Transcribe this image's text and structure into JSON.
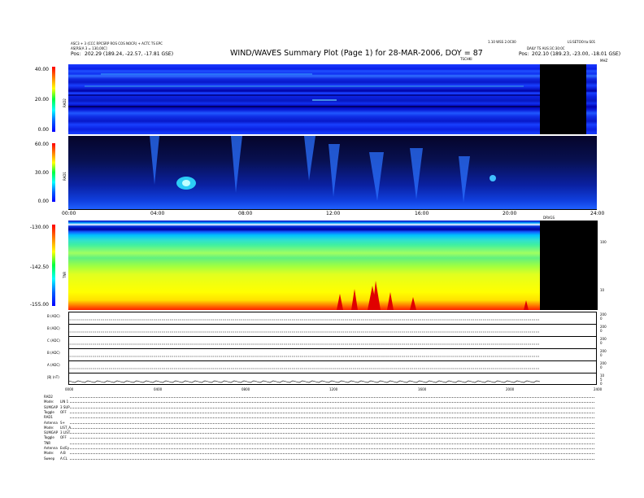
{
  "header": {
    "left_line1": "ASC3 + 3 (CCC RPCSRP ROS COS NOCR) + ACTC TS EPC",
    "left_line2": "AS[RS(A 3 = 130,00C]",
    "left_pos_label": "Pos:",
    "left_pos_value": "202.29 (189.24, -22.57, -17.81 GSE)",
    "title": "WIND/WAVES Summary Plot (Page 1) for 28-MAR-2006, DOY = 87",
    "right_line1": "1.10 WSS 2.0C00",
    "right_line2": "LS:SETOO:ta:S01",
    "right_line3": "DAILY TS AUS:3C:30:0C",
    "right_pos_label": "Pos:",
    "right_pos_value": "202.10 (189.23, -23.00, -18.01 GSE)",
    "freq_label": "TSCHKI",
    "mhz_label": "MHZ",
    "ox_label": "0"
  },
  "colors": {
    "background": "#ffffff",
    "spectrogram_dark": "#0000a0",
    "spectrogram_mid": "#1040f0",
    "black_gap": "#000000",
    "colorbar_top": "#ff0000",
    "colorbar_bottom": "#0000ff"
  },
  "panels": {
    "rad2": {
      "name": "RAD2",
      "colorbar_ticks": [
        "40.00",
        "20.00",
        "0.00"
      ]
    },
    "rad1": {
      "name": "RAD1",
      "colorbar_ticks": [
        "60.00",
        "30.00",
        "0.00"
      ]
    },
    "tnr": {
      "name": "TNR",
      "colorbar_ticks": [
        "-130.00",
        "-142.50",
        "-155.00"
      ],
      "right_ticks": [
        "100",
        "10"
      ],
      "gap_label": "DRVGS"
    }
  },
  "time_axis_top": [
    "00:00",
    "04:00",
    "08:00",
    "12:00",
    "16:00",
    "20:00",
    "24:00"
  ],
  "time_axis_bottom": [
    "0000",
    "0400",
    "0800",
    "1200",
    "1600",
    "2000",
    "2400"
  ],
  "lineplots": [
    {
      "label": "B (ADC)",
      "right": "200\n0"
    },
    {
      "label": "B (ADC)",
      "right": "200\n0"
    },
    {
      "label": "C (ADC)",
      "right": "200\n0"
    },
    {
      "label": "B (ADC)",
      "right": "200\n0"
    },
    {
      "label": "A (ADC)",
      "right": "200\n0"
    },
    {
      "label": "|B| (nT)",
      "right": "10\n5\n0"
    }
  ],
  "bottom_block": [
    {
      "k": "RAD2",
      "v": ""
    },
    {
      "k": "Mode:",
      "v": "LIN 1"
    },
    {
      "k": "SUMGAP",
      "v": "3 SUP"
    },
    {
      "k": "Toggle",
      "v": "OFF"
    },
    {
      "k": "RAD1",
      "v": ""
    },
    {
      "k": "Antenna",
      "v": "S+"
    },
    {
      "k": "Mode:",
      "v": "LIST_A"
    },
    {
      "k": "SUMGAP",
      "v": "3 LIST"
    },
    {
      "k": "Toggle",
      "v": "OFF"
    },
    {
      "k": "TNR",
      "v": ""
    },
    {
      "k": "Antenna",
      "v": "Ex/Ey"
    },
    {
      "k": "Mode:",
      "v": "A:B"
    },
    {
      "k": "Sweep",
      "v": "A:CL"
    }
  ],
  "chart_data": [
    {
      "type": "heatmap",
      "title": "RAD2",
      "ylim": [
        0,
        40
      ],
      "x_range": [
        "00:00",
        "24:00"
      ],
      "data_gap": [
        "21:15",
        "23:30"
      ],
      "colorbar": [
        0,
        40
      ]
    },
    {
      "type": "heatmap",
      "title": "RAD1",
      "ylim": [
        0,
        60
      ],
      "x_range": [
        "00:00",
        "24:00"
      ],
      "colorbar": [
        0,
        60
      ]
    },
    {
      "type": "heatmap",
      "title": "TNR",
      "ylim": [
        -155,
        -130
      ],
      "x_range": [
        "00:00",
        "24:00"
      ],
      "data_gap": [
        "21:15",
        "24:00"
      ],
      "colorbar": [
        -155,
        -130
      ]
    }
  ]
}
